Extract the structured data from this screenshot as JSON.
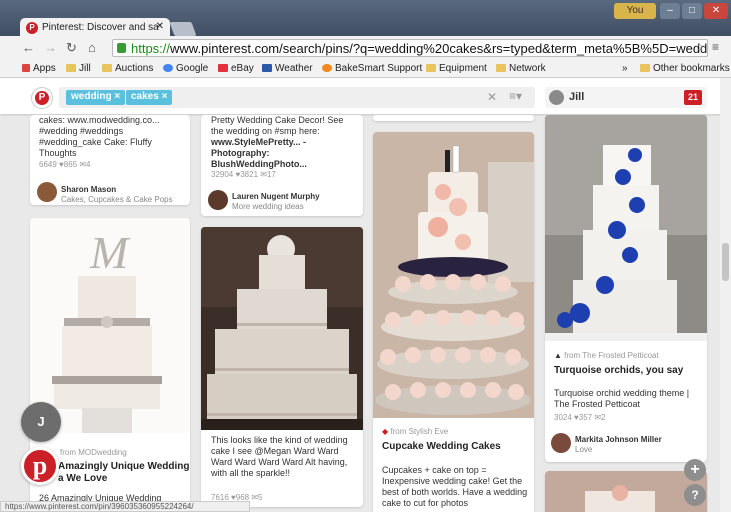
{
  "browser": {
    "tab_title": "Pinterest: Discover and sa",
    "tab_close": "✕",
    "url_scheme": "https://",
    "url_rest": "www.pinterest.com/search/pins/?q=wedding%20cakes&rs=typed&term_meta%5B%5D=wedd",
    "profile_label": "You",
    "bookmarks": [
      "Apps",
      "Jill",
      "Auctions",
      "Google",
      "eBay",
      "Weather",
      "BakeSmart Support",
      "Equipment",
      "Network",
      "Other bookmarks"
    ],
    "more_chevron": "»",
    "status_url": "https://www.pinterest.com/pin/396035360955224264/"
  },
  "header": {
    "search_tokens": [
      "wedding",
      "cakes"
    ],
    "token_close": "×",
    "user_name": "Jill",
    "notification_count": "21"
  },
  "pins": {
    "c1a": {
      "desc": "cakes: www.modwedding.co... #wedding #weddings #wedding_cake Cake: Fluffy Thoughts",
      "stats": "6649  ♥865  ✉4",
      "pinner_name": "Sharon Mason",
      "pinner_board": "Cakes, Cupcakes & Cake Pops"
    },
    "c2a": {
      "desc_lines": [
        "Pretty Wedding Cake Decor! See",
        "the wedding on #smp here:"
      ],
      "desc_bold": "www.StyleMePretty... - Photography:",
      "desc_bold2": "BlushWeddingPhoto...",
      "stats": "32904  ♥3821  ✉17",
      "pinner_name": "Lauren Nugent Murphy",
      "pinner_board": "More wedding ideas"
    },
    "c1b": {
      "from": "from MODwedding",
      "caption": "Amazingly Unique Wedding",
      "caption2": "a We Love",
      "desc": "26 Amazingly Unique Wedding"
    },
    "c2b": {
      "desc": "This looks like the kind of wedding cake I see @Megan Ward Ward Ward Ward Ward Ward Alt having, with all the sparkle!!",
      "stats": "7616  ♥968  ✉5"
    },
    "c3b": {
      "from": "from Stylish Eve",
      "caption": "Cupcake Wedding Cakes",
      "desc": "Cupcakes + cake on top = Inexpensive wedding cake! Get the best of both worlds. Have a wedding cake to cut for photos"
    },
    "c4a": {
      "from": "from The Frosted Petticoat",
      "caption": "Turquoise orchids, you say",
      "desc": "Turquoise orchid wedding theme | The Frosted Petticoat",
      "stats": "3024  ♥357  ✉2",
      "pinner_name": "Markita Johnson Miller",
      "pinner_board": "Love"
    }
  },
  "floating": {
    "avatar_letter": "J",
    "add_symbol": "+",
    "help_symbol": "?"
  },
  "colors": {
    "pinterest_red": "#cb2027",
    "token_blue": "#5bc0de",
    "orchid_blue": "#1e3fb0",
    "https_green": "#1d8a1d"
  }
}
